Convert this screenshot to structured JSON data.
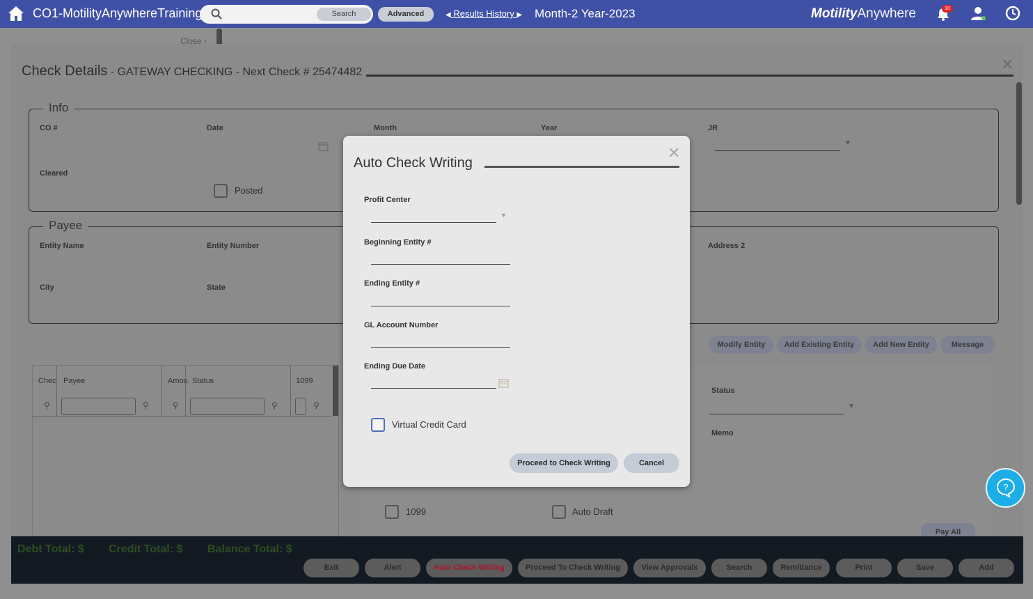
{
  "topbar": {
    "title": "CO1-MotilityAnywhereTraining",
    "search_label": "Search",
    "advanced_label": "Advanced",
    "results_history": "Results History",
    "period": "Month-2 Year-2023",
    "brand_bold": "Motility",
    "brand_light": "Anywhere",
    "notification_count": "10"
  },
  "background": {
    "close_label": "Close",
    "header_title": "Check Details",
    "header_subtitle": " - GATEWAY CHECKING - Next Check # 25474482",
    "info": {
      "legend": "Info",
      "co_label": "CO #",
      "date_label": "Date",
      "month_label": "Month",
      "year_label": "Year",
      "jr_label": "JR",
      "cleared_label": "Cleared",
      "posted_label": "Posted"
    },
    "payee": {
      "legend": "Payee",
      "entity_name_label": "Entity Name",
      "entity_number_label": "Entity Number",
      "address2_label": "Address 2",
      "city_label": "City",
      "state_label": "State"
    },
    "entity_buttons": [
      "Modify Entity",
      "Add Existing Entity",
      "Add New Entity",
      "Message"
    ],
    "grid_headers": [
      "Chec",
      "Payee",
      "Amou",
      "Status",
      "1099"
    ],
    "detail": {
      "status_label": "Status",
      "memo_label": "Memo",
      "cb_1099": "1099",
      "cb_auto_draft": "Auto Draft",
      "pay_all": "Pay All"
    }
  },
  "footer": {
    "debt_total": "Debt Total: $",
    "credit_total": "Credit Total: $",
    "balance_total": "Balance Total: $",
    "buttons": [
      "Exit",
      "Alert",
      "Auto Check Writing",
      "Proceed To Check Writing",
      "View Approvals",
      "Search",
      "Remittance",
      "Print",
      "Save",
      "Add"
    ],
    "active_button_color": "#b0142b"
  },
  "modal": {
    "title": "Auto Check Writing",
    "profit_center_label": "Profit Center",
    "beginning_entity_label": "Beginning Entity #",
    "ending_entity_label": "Ending Entity #",
    "gl_account_label": "GL Account Number",
    "ending_due_date_label": "Ending Due Date",
    "virtual_credit_card_label": "Virtual Credit Card",
    "proceed_label": "Proceed to Check Writing",
    "cancel_label": "Cancel"
  }
}
